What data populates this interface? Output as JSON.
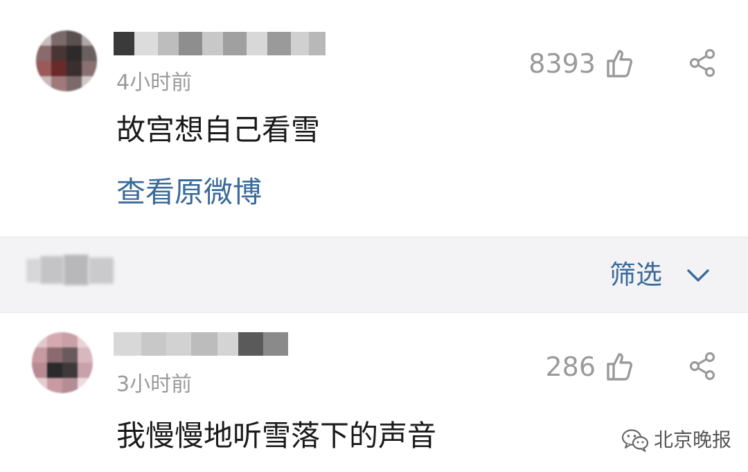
{
  "comments": [
    {
      "time": "4小时前",
      "likes": "8393",
      "text": "故宫想自己看雪",
      "link": "查看原微博"
    },
    {
      "time": "3小时前",
      "likes": "286",
      "text": "我慢慢地听雪落下的声音"
    }
  ],
  "filter": {
    "label": "筛选"
  },
  "watermark": {
    "text": "北京晚报"
  },
  "colors": {
    "link": "#3a6a9a",
    "secondary_text": "#9a9a9a",
    "body_text": "#1a1a1a",
    "filter_bar_bg": "#f3f3f5"
  },
  "icons": {
    "like": "thumbs-up-icon",
    "share": "share-icon",
    "filter_chevron": "chevron-down-icon",
    "watermark_logo": "wechat-icon"
  }
}
